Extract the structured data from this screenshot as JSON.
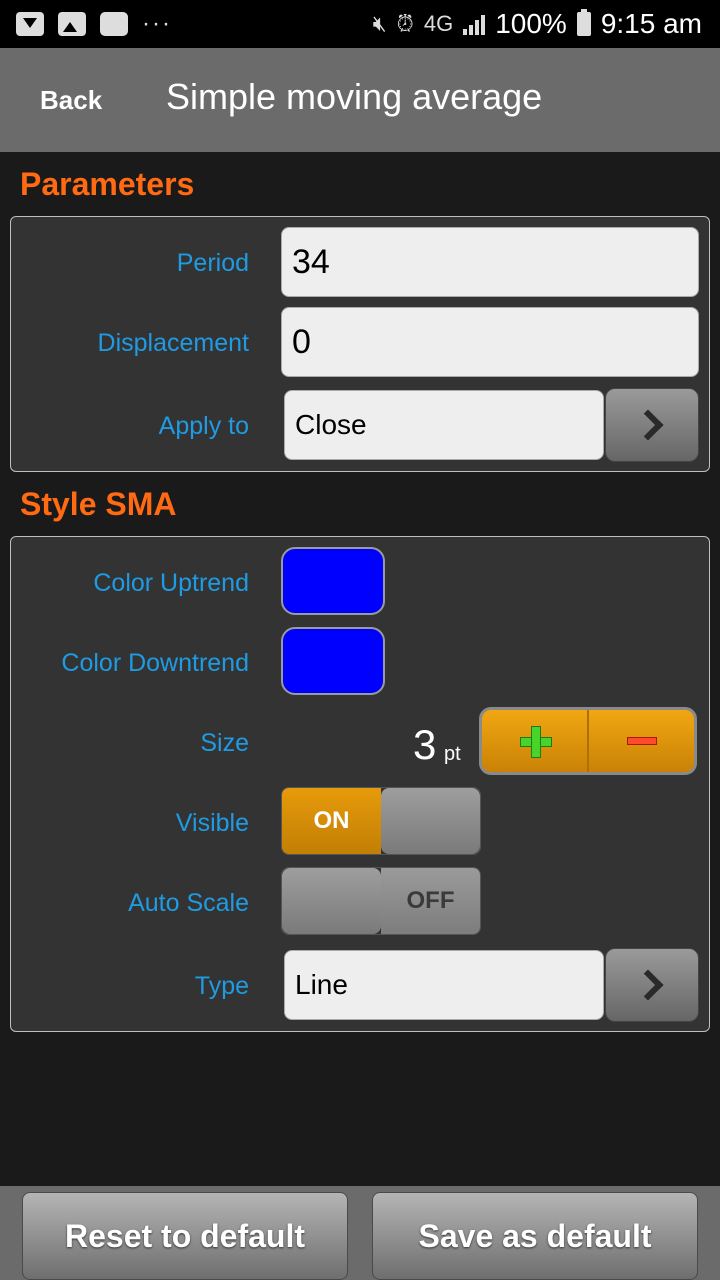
{
  "status_bar": {
    "network": "4G",
    "battery": "100%",
    "time": "9:15 am",
    "dots": "···"
  },
  "header": {
    "back_label": "Back",
    "title": "Simple moving average"
  },
  "parameters": {
    "section_title": "Parameters",
    "period": {
      "label": "Period",
      "value": "34"
    },
    "displacement": {
      "label": "Displacement",
      "value": "0"
    },
    "apply_to": {
      "label": "Apply to",
      "value": "Close"
    }
  },
  "style": {
    "section_title": "Style SMA",
    "color_uptrend": {
      "label": "Color Uptrend",
      "color": "#0000ff"
    },
    "color_downtrend": {
      "label": "Color Downtrend",
      "color": "#0000ff"
    },
    "size": {
      "label": "Size",
      "value": "3",
      "unit": "pt"
    },
    "visible": {
      "label": "Visible",
      "state": "ON"
    },
    "auto_scale": {
      "label": "Auto Scale",
      "state": "OFF"
    },
    "type": {
      "label": "Type",
      "value": "Line"
    }
  },
  "footer": {
    "reset_label": "Reset to default",
    "save_label": "Save as default"
  },
  "colors": {
    "accent_orange": "#ff6a13",
    "label_blue": "#1e9be3",
    "toggle_on": "#e79b0b"
  }
}
